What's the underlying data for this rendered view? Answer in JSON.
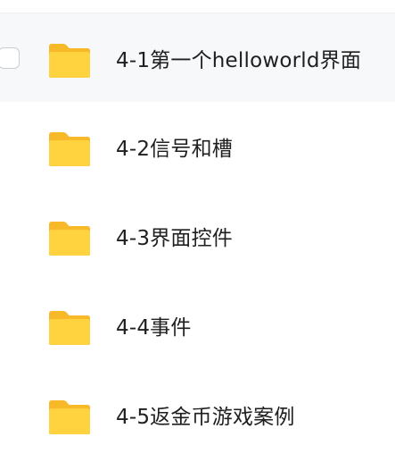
{
  "file_list": {
    "items": [
      {
        "name": "4-1第一个helloworld界面",
        "icon": "folder-icon",
        "hovered": true
      },
      {
        "name": "4-2信号和槽",
        "icon": "folder-icon",
        "hovered": false
      },
      {
        "name": "4-3界面控件",
        "icon": "folder-icon",
        "hovered": false
      },
      {
        "name": "4-4事件",
        "icon": "folder-icon",
        "hovered": false
      },
      {
        "name": "4-5返金币游戏案例",
        "icon": "folder-icon",
        "hovered": false
      }
    ]
  },
  "colors": {
    "folder_back": "#f7b928",
    "folder_front": "#ffd23f",
    "hover_background": "#f7f8fa"
  }
}
